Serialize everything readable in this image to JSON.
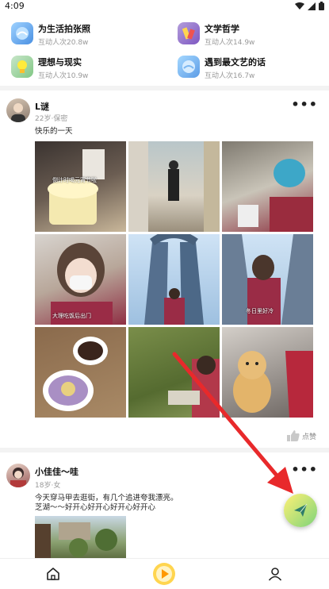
{
  "status_bar": {
    "time": "4:09"
  },
  "topics": [
    {
      "name": "为生活拍张照",
      "count": "互动人次20.8w",
      "icon": "camera-topic-icon"
    },
    {
      "name": "文学哲学",
      "count": "互动人次14.9w",
      "icon": "books-topic-icon"
    },
    {
      "name": "理想与现实",
      "count": "互动人次10.9w",
      "icon": "bulb-topic-icon"
    },
    {
      "name": "遇到最文艺的话",
      "count": "互动人次16.7w",
      "icon": "quote-topic-icon"
    }
  ],
  "posts": [
    {
      "username": "L谜",
      "meta": "22岁·保密",
      "text": "快乐的一天",
      "photo_texts": [
        "倒计时喝元宵节啦",
        "大理吃饭后出门",
        "冬日里好冷"
      ],
      "like_label": "点赞"
    },
    {
      "username": "小佳佳～哇",
      "meta": "18岁·女",
      "text_line1": "今天穿马甲去逛街，有几个追进夸我漂亮。",
      "text_line2": "芝湖〜〜好开心好开心好开心好开心"
    }
  ],
  "colors": {
    "arrow": "#e8292b",
    "fab_start": "#fff176",
    "fab_end": "#7ed37a",
    "divider": "#f3f3f3"
  }
}
